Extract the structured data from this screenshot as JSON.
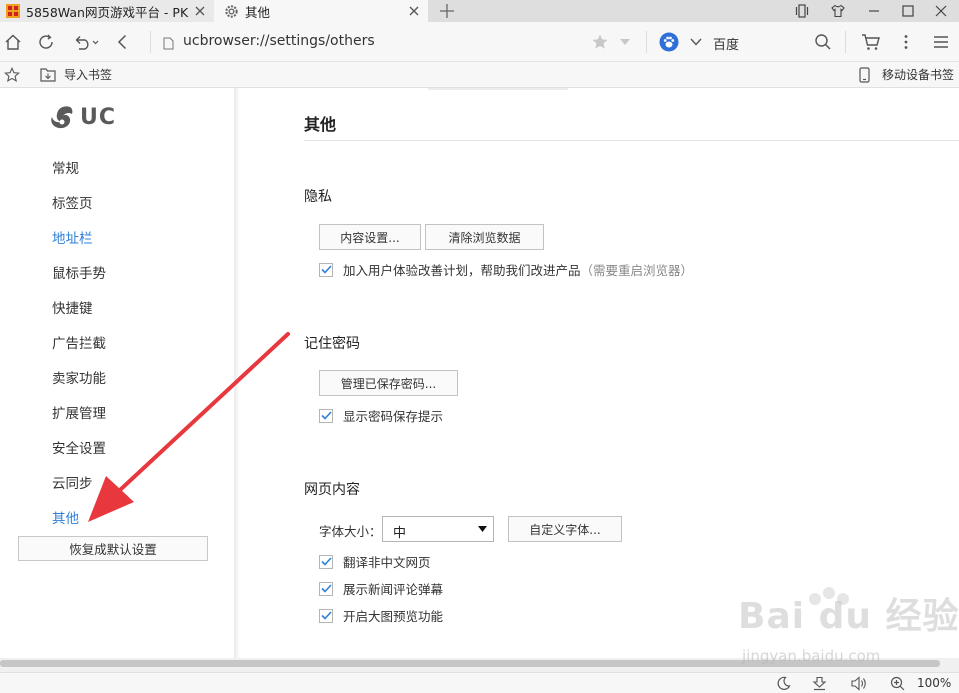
{
  "tabs": [
    {
      "title": "5858Wan网页游戏平台 - PK"
    },
    {
      "title": "其他"
    }
  ],
  "address_bar": {
    "url": "ucbrowser://settings/others",
    "search_engine": "百度"
  },
  "bookmark_bar": {
    "import_label": "导入书签",
    "mobile_bookmarks_label": "移动设备书签"
  },
  "sidebar": {
    "logo_text": "UC",
    "items": [
      {
        "label": "常规"
      },
      {
        "label": "标签页"
      },
      {
        "label": "地址栏"
      },
      {
        "label": "鼠标手势"
      },
      {
        "label": "快捷键"
      },
      {
        "label": "广告拦截"
      },
      {
        "label": "卖家功能"
      },
      {
        "label": "扩展管理"
      },
      {
        "label": "安全设置"
      },
      {
        "label": "云同步"
      },
      {
        "label": "其他"
      }
    ],
    "reset_button": "恢复成默认设置"
  },
  "main": {
    "title": "其他",
    "privacy": {
      "heading": "隐私",
      "content_settings_button": "内容设置...",
      "clear_data_button": "清除浏览数据",
      "ux_plan_label": "加入用户体验改善计划，帮助我们改进产品",
      "ux_plan_note": "（需要重启浏览器）",
      "ux_plan_checked": true
    },
    "passwords": {
      "heading": "记住密码",
      "manage_button": "管理已保存密码...",
      "show_prompt_label": "显示密码保存提示",
      "show_prompt_checked": true
    },
    "web_content": {
      "heading": "网页内容",
      "font_size_label": "字体大小：",
      "font_size_value": "中",
      "custom_font_button": "自定义字体...",
      "translate_label": "翻译非中文网页",
      "news_danmaku_label": "展示新闻评论弹幕",
      "image_preview_label": "开启大图预览功能",
      "translate_checked": true,
      "news_danmaku_checked": true,
      "image_preview_checked": true
    }
  },
  "status_bar": {
    "zoom": "100%"
  },
  "watermark": {
    "text": "Bai du 经验",
    "url": "jingyan.baidu.com"
  },
  "colors": {
    "active_nav": "#2f7fd8",
    "checkmark": "#2f7fd8",
    "annotation_arrow": "#e8383d"
  }
}
